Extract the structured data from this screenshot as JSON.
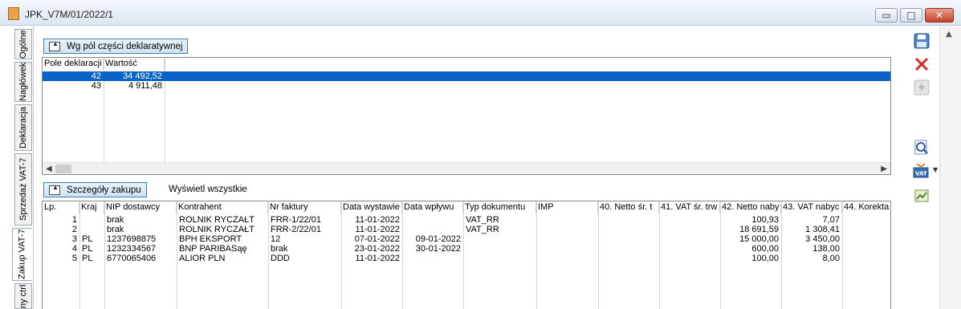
{
  "window": {
    "title": "JPK_V7M/01/2022/1"
  },
  "left_tabs": [
    "Ogólne",
    "Nagłówek",
    "Deklaracja",
    "Sprzedaż VAT-7",
    "Zakup VAT-7",
    "ny ctrl"
  ],
  "declaration": {
    "button_label": "Wg pól części deklaratywnej",
    "columns": [
      "Pole deklaracji",
      "Wartość"
    ],
    "rows": [
      {
        "field": "42",
        "value": "34 492,52"
      },
      {
        "field": "43",
        "value": "4 911,48"
      }
    ]
  },
  "purchases": {
    "button_label": "Szczegóły zakupu",
    "show_all_label": "Wyświetl wszystkie",
    "columns": [
      "Lp.",
      "Kraj",
      "NIP dostawcy",
      "Kontrahent",
      "Nr faktury",
      "Data wystawie",
      "Data wpływu",
      "Typ dokumentu",
      "IMP",
      "40. Netto śr. t",
      "41. VAT śr. trw",
      "42. Netto naby",
      "43. VAT nabyc",
      "44. Korekta"
    ],
    "rows": [
      {
        "lp": "1",
        "kraj": "",
        "nip": "brak",
        "kontrahent": "ROLNIK RYCZAŁT",
        "nr": "FRR-1/22/01",
        "data_wyst": "11-01-2022",
        "data_wpl": "",
        "typ": "VAT_RR",
        "netto42": "100,93",
        "vat43": "7,07"
      },
      {
        "lp": "2",
        "kraj": "",
        "nip": "brak",
        "kontrahent": "ROLNIK RYCZAŁT",
        "nr": "FRR-2/22/01",
        "data_wyst": "11-01-2022",
        "data_wpl": "",
        "typ": "VAT_RR",
        "netto42": "18 691,59",
        "vat43": "1 308,41"
      },
      {
        "lp": "3",
        "kraj": "PL",
        "nip": "1237698875",
        "kontrahent": "BPH EKSPORT",
        "nr": "12",
        "data_wyst": "07-01-2022",
        "data_wpl": "09-01-2022",
        "typ": "",
        "netto42": "15 000,00",
        "vat43": "3 450,00"
      },
      {
        "lp": "4",
        "kraj": "PL",
        "nip": "1232334567",
        "kontrahent": "BNP PARIBASąę",
        "nr": "brak",
        "data_wyst": "23-01-2022",
        "data_wpl": "30-01-2022",
        "typ": "",
        "netto42": "600,00",
        "vat43": "138,00"
      },
      {
        "lp": "5",
        "kraj": "PL",
        "nip": "6770065406",
        "kontrahent": "ALIOR PLN",
        "nr": "DDD",
        "data_wyst": "11-01-2022",
        "data_wpl": "",
        "typ": "",
        "netto42": "100,00",
        "vat43": "8,00"
      }
    ]
  },
  "toolbar_icons": [
    "save-icon",
    "cancel-icon",
    "lightning-icon",
    "preview-icon",
    "vat-icon",
    "export-icon"
  ],
  "colors": {
    "selection": "#0a64c8",
    "button_border": "#3c7fb1",
    "close": "#c4432b"
  }
}
